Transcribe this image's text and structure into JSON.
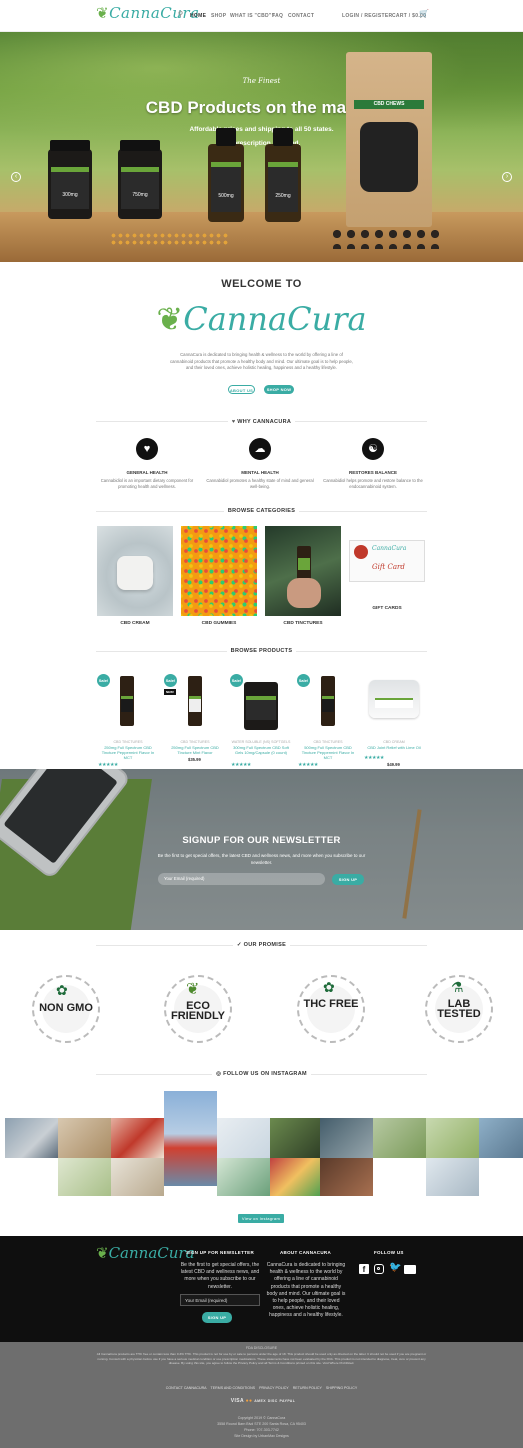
{
  "header": {
    "logo": "CannaCura",
    "nav": [
      "HOME",
      "SHOP",
      "WHAT IS \"CBD\"?",
      "FAQ",
      "CONTACT"
    ],
    "login": "LOGIN / REGISTER",
    "cart": "CART / $0.00"
  },
  "hero": {
    "kicker": "The Finest",
    "title": "CBD Products on the market",
    "line1": "Affordable prices and shipping to all 50 states.",
    "line2": "No prescription required.",
    "bag_label": "CBD CHEWS",
    "jar_labels": [
      "300mg",
      "750mg",
      "500mg",
      "250mg"
    ]
  },
  "welcome": {
    "heading": "WELCOME TO",
    "logo": "CannaCura",
    "body": "CannaCura is dedicated to bringing health & wellness to the world by offering a line of cannabinoid products that promote a healthy body and mind. Our ultimate goal is to help people, and their loved ones, achieve holistic healing, happiness and a healthy lifestyle.",
    "about_btn": "ABOUT US",
    "shop_btn": "SHOP NOW"
  },
  "why": {
    "heading": "WHY CANNACURA",
    "features": [
      {
        "icon": "heart-monitor-icon",
        "title": "GENERAL HEALTH",
        "desc": "Cannabidiol is an important dietary component for promoting health and wellness."
      },
      {
        "icon": "brain-icon",
        "title": "MENTAL HEALTH",
        "desc": "Cannabidiol promotes a healthy state of mind and general well-being."
      },
      {
        "icon": "meditation-icon",
        "title": "RESTORES BALANCE",
        "desc": "Cannabidiol helps promote and restore balance to the endocannabinoid system."
      }
    ]
  },
  "categories": {
    "heading": "BROWSE CATEGORIES",
    "items": [
      "CBD CREAM",
      "CBD GUMMIES",
      "CBD TINCTURES",
      "GIFT CARDS"
    ],
    "gift_card_text": "Gift Card"
  },
  "products": {
    "heading": "BROWSE PRODUCTS",
    "sale_label": "Sale!",
    "new_label": "NEW!",
    "items": [
      {
        "cat": "CBD TINCTURES",
        "name": "250mg Full Spectrum CBD Tincture Peppermint Flavor In MCT",
        "old": "$35.99",
        "price": "$35.99",
        "sale": true
      },
      {
        "cat": "CBD TINCTURES",
        "name": "250mg Full Spectrum CBD Tincture Mint Flavor",
        "old": "",
        "price": "$35.99",
        "sale": true
      },
      {
        "cat": "WATER SOLUBLE (NS) SOFTGELS",
        "name": "300mg Full Spectrum CBD Soft Gels 10mg/Capsule (0 count)",
        "old": "",
        "price": "$39.95",
        "sale": true
      },
      {
        "cat": "CBD TINCTURES",
        "name": "500mg Full Spectrum CBD Tincture Peppermint Flavor In MCT",
        "old": "",
        "price": "$49.99",
        "sale": true
      },
      {
        "cat": "CBD CREAM",
        "name": "CBD Joint Relief with Lime Oil",
        "old": "",
        "price": "$49.99",
        "sale": false
      }
    ]
  },
  "newsletter": {
    "heading": "SIGNUP FOR OUR NEWSLETTER",
    "body": "Be the first to get special offers, the latest CBD and wellness news, and more when you subscribe to our newsletter.",
    "placeholder": "Your Email (required)",
    "button": "SIGN UP"
  },
  "promise": {
    "heading": "OUR PROMISE",
    "badges": [
      {
        "big": "NON GMO",
        "ring": "NO GENETICALLY MODIFIED ORGANISMS"
      },
      {
        "big": "ECO FRIENDLY",
        "ring": "NO PESTICIDES • SUSTAINABLE"
      },
      {
        "big": "THC FREE",
        "ring": "DOES NOT CONTAIN TETRAHYDROCANNABINOL"
      },
      {
        "big": "LAB TESTED",
        "ring": "3RD PARTY CERTIFIED FOR PURITY & POTENCY"
      }
    ]
  },
  "instagram": {
    "heading": "FOLLOW US ON INSTAGRAM",
    "button": "View on Instagram"
  },
  "footer": {
    "logo": "CannaCura",
    "signup_heading": "SIGN UP FOR NEWSLETTER",
    "signup_text": "Be the first to get special offers, the latest CBD and wellness news, and more when you subscribe to our newsletter.",
    "email_placeholder": "Your Email (required)",
    "signup_button": "SIGN UP",
    "about_heading": "ABOUT CANNACURA",
    "about_text": "CannaCura is dedicated to bringing health & wellness to the world by offering a line of cannabinoid products that promote a healthy body and mind. Our ultimate goal is to help people, and their loved ones, achieve holistic healing, happiness and a healthy lifestyle.",
    "follow_heading": "FOLLOW US",
    "social": [
      "facebook-icon",
      "instagram-icon",
      "twitter-icon",
      "email-icon"
    ]
  },
  "bottom": {
    "fda_title": "FDA DISCLOSURE",
    "fda_text": "All CannaCura products are THC free or contain less than 0.3% THC. This product is not for use by or sale to persons under the age of 18. This product should be used only as directed on the label. It should not be used if you are pregnant or nursing. Consult with a physician before use if you have a serious medical condition or use prescription medications. These statements have not been evaluated by the FDA. This product is not intended to diagnose, treat, cure or prevent any disease. By using this site, you agree to follow the Privacy Policy and all Terms & Conditions printed on this site. Void Where Prohibited.",
    "links": [
      "CONTACT CANNACURA",
      "TERMS AND CONDITIONS",
      "PRIVACY POLICY",
      "RETURN POLICY",
      "SHIPPING POLICY"
    ],
    "payments": [
      "VISA",
      "MC",
      "AMEX",
      "DISC",
      "PAYPAL"
    ],
    "copyright": "Copyright 2019 © CannaCura",
    "address": "3558 Round Barn Blvd STE 200 Santa Rosa, CA 95403",
    "phone": "Phone: 707-303-7742",
    "credit": "Site Design by UrbanMax Designs"
  }
}
